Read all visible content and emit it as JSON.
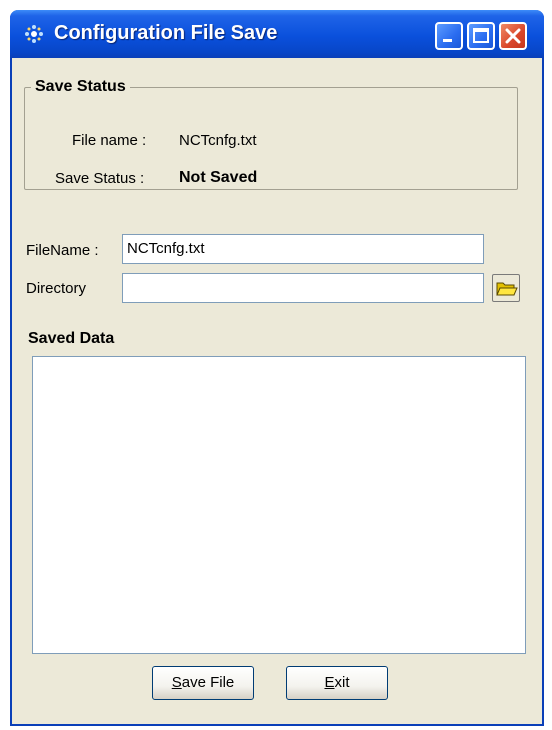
{
  "window": {
    "title": "Configuration File Save"
  },
  "save_status": {
    "legend": "Save Status",
    "file_name_label": "File name :",
    "file_name_value": "NCTcnfg.txt",
    "status_label": "Save Status :",
    "status_value": "Not Saved"
  },
  "form": {
    "filename_label": "FileName :",
    "filename_value": "NCTcnfg.txt",
    "directory_label": "Directory",
    "directory_value": ""
  },
  "saved_data": {
    "title": "Saved Data",
    "content": ""
  },
  "buttons": {
    "save_mnemonic": "S",
    "save_rest": "ave File",
    "exit_mnemonic": "E",
    "exit_rest": "xit"
  },
  "icons": {
    "app": "app-icon",
    "browse": "folder-icon"
  }
}
